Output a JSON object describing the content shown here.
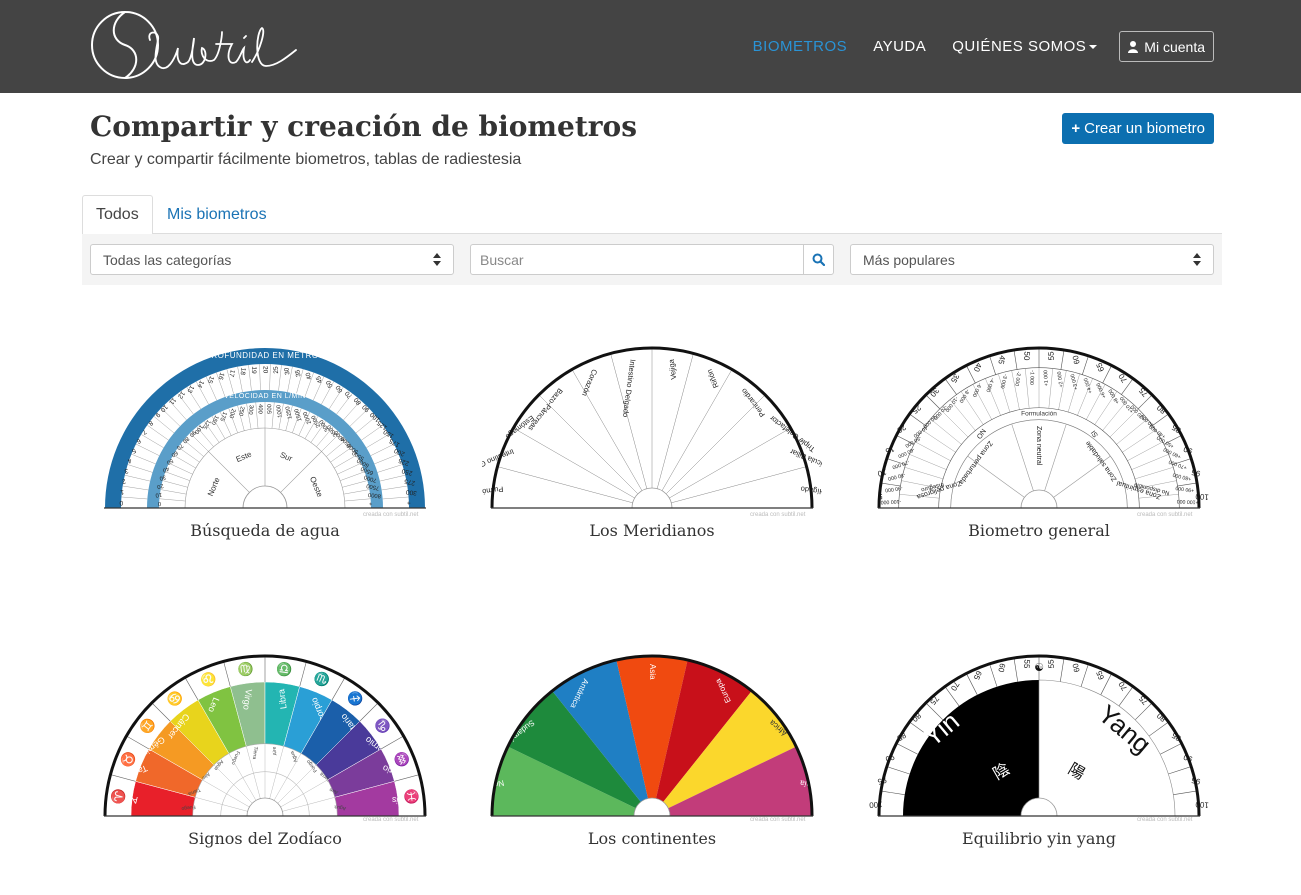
{
  "nav": {
    "logo_text": "Subtil",
    "links": [
      "Biometros",
      "Ayuda",
      "Quiénes somos"
    ],
    "account": "Mi cuenta"
  },
  "header": {
    "title": "Compartir y creación de biometros",
    "subtitle": "Crear y compartir fácilmente biometros, tablas de radiestesia",
    "create_button": "Crear un biometro"
  },
  "tabs": [
    "Todos",
    "Mis biometros"
  ],
  "filters": {
    "category": "Todas las categorías",
    "search_placeholder": "Buscar",
    "sort": "Más populares"
  },
  "credit": "creada con subtil.net",
  "cards": [
    {
      "title": "Búsqueda de agua",
      "outer_label": "PROFUNDIDAD EN METROS",
      "inner_label": "VELOCIDAD EN L/MIN",
      "depths": [
        "0",
        "1",
        "2",
        "3",
        "4",
        "5",
        "6",
        "7",
        "8",
        "9",
        "10",
        "11",
        "12",
        "13",
        "14",
        "15",
        "16",
        "17",
        "18",
        "19",
        "20",
        "25",
        "30",
        "35",
        "40",
        "45",
        "50",
        "60",
        "70",
        "80",
        "90",
        "100",
        "125",
        "150",
        "175",
        "200",
        "225",
        "250",
        "275",
        "300",
        "+"
      ],
      "speeds": [
        "0",
        "10",
        "20",
        "30",
        "40",
        "50",
        "60",
        "70",
        "80",
        "90",
        "100",
        "125",
        "150",
        "175",
        "200",
        "250",
        "300",
        "400",
        "500",
        "1000",
        "1250",
        "1500",
        "2000",
        "2500",
        "3000",
        "3500",
        "4000",
        "4500",
        "5000",
        "5500",
        "6000",
        "6500",
        "7000",
        "7500",
        "8000",
        "+"
      ],
      "directions": [
        "Norte",
        "Este",
        "Sur",
        "Oeste"
      ],
      "colors": {
        "outer": "#1f6fa8",
        "inner": "#5a9ec9"
      }
    },
    {
      "title": "Los Meridianos",
      "labels": [
        "Pulmón",
        "Intestino Grueso",
        "Estómago",
        "Bazo-Páncreas",
        "Corazón",
        "Intestino Delgado",
        "Vejiga",
        "Riñón",
        "Pericardio",
        "Triple Calefactor",
        "Vesícula Biliar",
        "Hígado"
      ]
    },
    {
      "title": "Biometro general",
      "outer_numbers": [
        "5",
        "10",
        "15",
        "20",
        "25",
        "30",
        "35",
        "40",
        "45",
        "50",
        "55",
        "60",
        "65",
        "70",
        "75",
        "80",
        "85",
        "90",
        "95",
        "100"
      ],
      "inner_numbers": [
        "-100 000",
        "-90 000",
        "-80 000",
        "-70 000",
        "-60 000",
        "-50 000",
        "-40 000",
        "-30 000",
        "-20 000",
        "-10 000",
        "-8 000",
        "-6 000",
        "-4 000",
        "-3 000",
        "-2 000",
        "-1 000",
        "+1 000",
        "+2 000",
        "+3 000",
        "+4 000",
        "+6 000",
        "+8 000",
        "+10 000",
        "+20 000",
        "+30 000",
        "+40 000",
        "+50 000",
        "+60 000",
        "+70 000",
        "+80 000",
        "+90 000",
        "+100 000"
      ],
      "band_labels": [
        "Inseguro",
        "NO",
        "Formulación",
        "SI",
        "No disponible"
      ],
      "zones": [
        "Zona peligrosa",
        "Zona perturbada",
        "Zona neutral",
        "Zona saludable",
        "Zona espiritual"
      ]
    },
    {
      "title": "Signos del Zodíaco",
      "signs": [
        "Aries",
        "Tauro",
        "Géminis",
        "Cáncer",
        "Leo",
        "Virgo",
        "Libra",
        "Escorpio",
        "Sagitario",
        "Capricornio",
        "Acuario",
        "Piscis"
      ],
      "symbols": [
        "♈",
        "♉",
        "♊",
        "♋",
        "♌",
        "♍",
        "♎",
        "♏",
        "♐",
        "♑",
        "♒",
        "♓"
      ],
      "elements": [
        "Fuego",
        "Tierra",
        "Aire",
        "Agua",
        "Fuego",
        "Tierra",
        "Aire",
        "Agua",
        "Fuego",
        "Tierra",
        "Aire",
        "Agua"
      ],
      "colors": [
        "#e8202a",
        "#f0682a",
        "#f59a23",
        "#e8d41c",
        "#80c341",
        "#8fbf8f",
        "#23b5b2",
        "#2a9fd6",
        "#1b5faa",
        "#4a3a9a",
        "#7b3c9b",
        "#a33aa0"
      ]
    },
    {
      "title": "Los continentes",
      "continents": [
        "Norteamérica",
        "Sudamérica",
        "Antártica",
        "Asia",
        "Europa",
        "África",
        "Oceanía"
      ],
      "colors": [
        "#5cb85c",
        "#1e8a3c",
        "#1f7fc4",
        "#f04a10",
        "#c8101a",
        "#fbd72c",
        "#c23c7a"
      ]
    },
    {
      "title": "Equilibrio yin yang",
      "yin": "Yin",
      "yang": "Yang",
      "yin_char": "陰",
      "yang_char": "陽",
      "center_symbol": "☯",
      "scale": [
        "100",
        "95",
        "90",
        "85",
        "80",
        "75",
        "70",
        "65",
        "60",
        "55",
        "55",
        "60",
        "65",
        "70",
        "75",
        "80",
        "85",
        "90",
        "95",
        "100"
      ]
    }
  ]
}
